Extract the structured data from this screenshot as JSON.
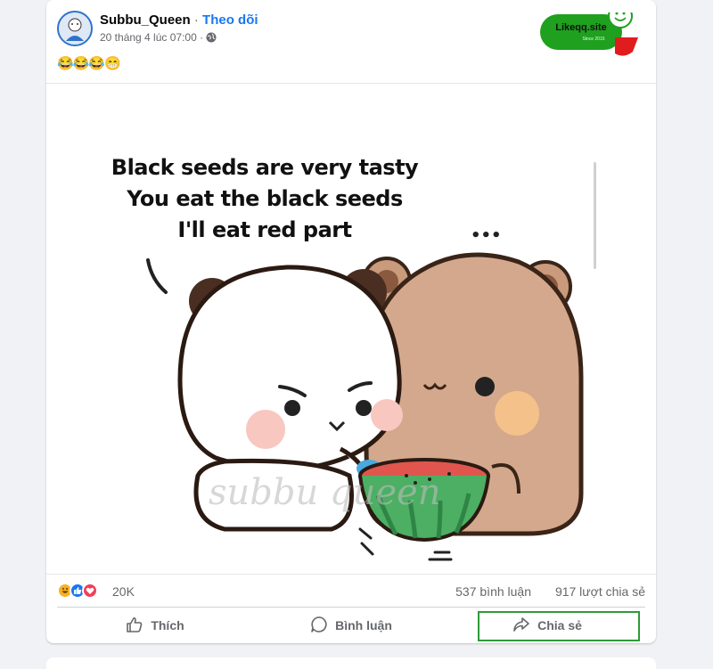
{
  "post": {
    "author": "Subbu_Queen",
    "separator": " · ",
    "follow_label": "Theo dõi",
    "timestamp": "20 tháng 4 lúc 07:00 ·",
    "caption": "😂😂😂😁",
    "audience_icon": "globe-icon",
    "menu_icon": "more-icon"
  },
  "badge": {
    "site": "Likeqq.site",
    "since": "Since 2015",
    "colors": {
      "body": "#1fa01f",
      "accent": "#e11c1c"
    }
  },
  "meme": {
    "lines": [
      "Black seeds are very tasty",
      "You eat the black seeds",
      "I'll eat red part"
    ],
    "ellipsis": "•••",
    "watermark": "subbu queen"
  },
  "stats": {
    "reaction_count": "20K",
    "reaction_icons": [
      "haha-icon",
      "like-icon",
      "love-icon"
    ],
    "comments": "537 bình luận",
    "shares": "917 lượt chia sẻ"
  },
  "actions": {
    "like_label": "Thích",
    "comment_label": "Bình luận",
    "share_label": "Chia sẻ"
  },
  "colors": {
    "brand_blue": "#1877f2",
    "muted_text": "#65676b",
    "highlight_box": "#2e9a3a"
  }
}
